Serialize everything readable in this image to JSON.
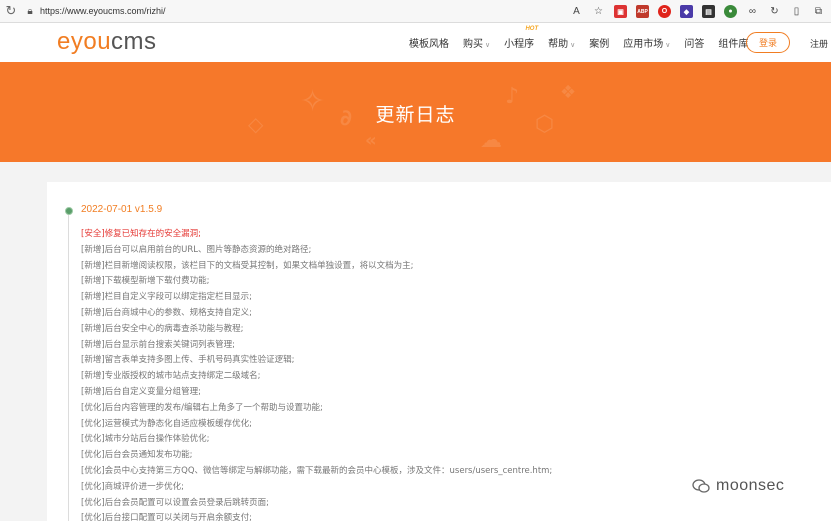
{
  "browser": {
    "url": "https://www.eyoucms.com/rizhi/"
  },
  "logo": {
    "part1": "eyou",
    "part2": "cms"
  },
  "nav": {
    "items": [
      {
        "label": "模板风格",
        "caret": false,
        "hot": false
      },
      {
        "label": "购买",
        "caret": true,
        "hot": false
      },
      {
        "label": "小程序",
        "caret": false,
        "hot": true
      },
      {
        "label": "帮助",
        "caret": true,
        "hot": false
      },
      {
        "label": "案例",
        "caret": false,
        "hot": false
      },
      {
        "label": "应用市场",
        "caret": true,
        "hot": false
      },
      {
        "label": "问答",
        "caret": false,
        "hot": false
      },
      {
        "label": "组件库",
        "caret": false,
        "hot": false
      }
    ],
    "hot_badge": "HOT",
    "login": "登录",
    "register": "注册"
  },
  "banner": {
    "title": "更新日志"
  },
  "log": {
    "version": "2022-07-01 v1.5.9",
    "changes": [
      "[安全]修复已知存在的安全漏洞;",
      "[新增]后台可以启用前台的URL、图片等静态资源的绝对路径;",
      "[新增]栏目新增阅读权限，该栏目下的文档受其控制，如果文档单独设置，将以文档为主;",
      "[新增]下载模型新增下载付费功能;",
      "[新增]栏目自定义字段可以绑定指定栏目显示;",
      "[新增]后台商城中心的参数、规格支持自定义;",
      "[新增]后台安全中心的病毒查杀功能与教程;",
      "[新增]后台显示前台搜索关键词列表管理;",
      "[新增]留言表单支持多图上传、手机号码真实性验证逻辑;",
      "[新增]专业版授权的城市站点支持绑定二级域名;",
      "[新增]后台自定义变量分组管理;",
      "[优化]后台内容管理的发布/编辑右上角多了一个帮助与设置功能;",
      "[优化]运营模式为静态化自适应模板缓存优化;",
      "[优化]城市分站后台操作体验优化;",
      "[优化]后台会员通知发布功能;",
      "[优化]会员中心支持第三方QQ、微信等绑定与解绑功能，需下载最新的会员中心模板，涉及文件：users/users_centre.htm;",
      "[优化]商城评价进一步优化;",
      "[优化]后台会员配置可以设置会员登录后跳转页面;",
      "[优化]后台接口配置可以关闭与开启余额支付;"
    ]
  },
  "watermark": {
    "text": "moonsec"
  },
  "colors": {
    "brand": "#f17d22",
    "banner": "#f6782a",
    "security": "#e53935",
    "dot": "#5a9e6a"
  }
}
